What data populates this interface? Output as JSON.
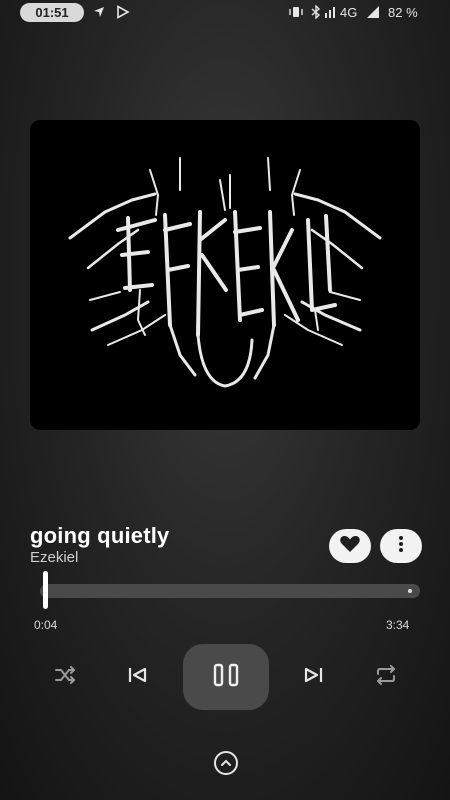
{
  "status_bar": {
    "time": "01:51",
    "network": "4G",
    "battery": "82 %"
  },
  "album": {
    "art_icon": "ezekiel-logo-art"
  },
  "track": {
    "title": "going quietly",
    "artist": "Ezekiel"
  },
  "progress": {
    "elapsed": "0:04",
    "duration": "3:34",
    "fraction": 0.019
  },
  "controls": {
    "shuffle_icon": "shuffle-icon",
    "previous_icon": "skip-previous-icon",
    "play_pause_icon": "pause-icon",
    "next_icon": "skip-next-icon",
    "repeat_icon": "repeat-icon"
  },
  "colors": {
    "background": "#262626",
    "button_light": "#f2f2f2",
    "play_button": "#4a4a4a"
  }
}
